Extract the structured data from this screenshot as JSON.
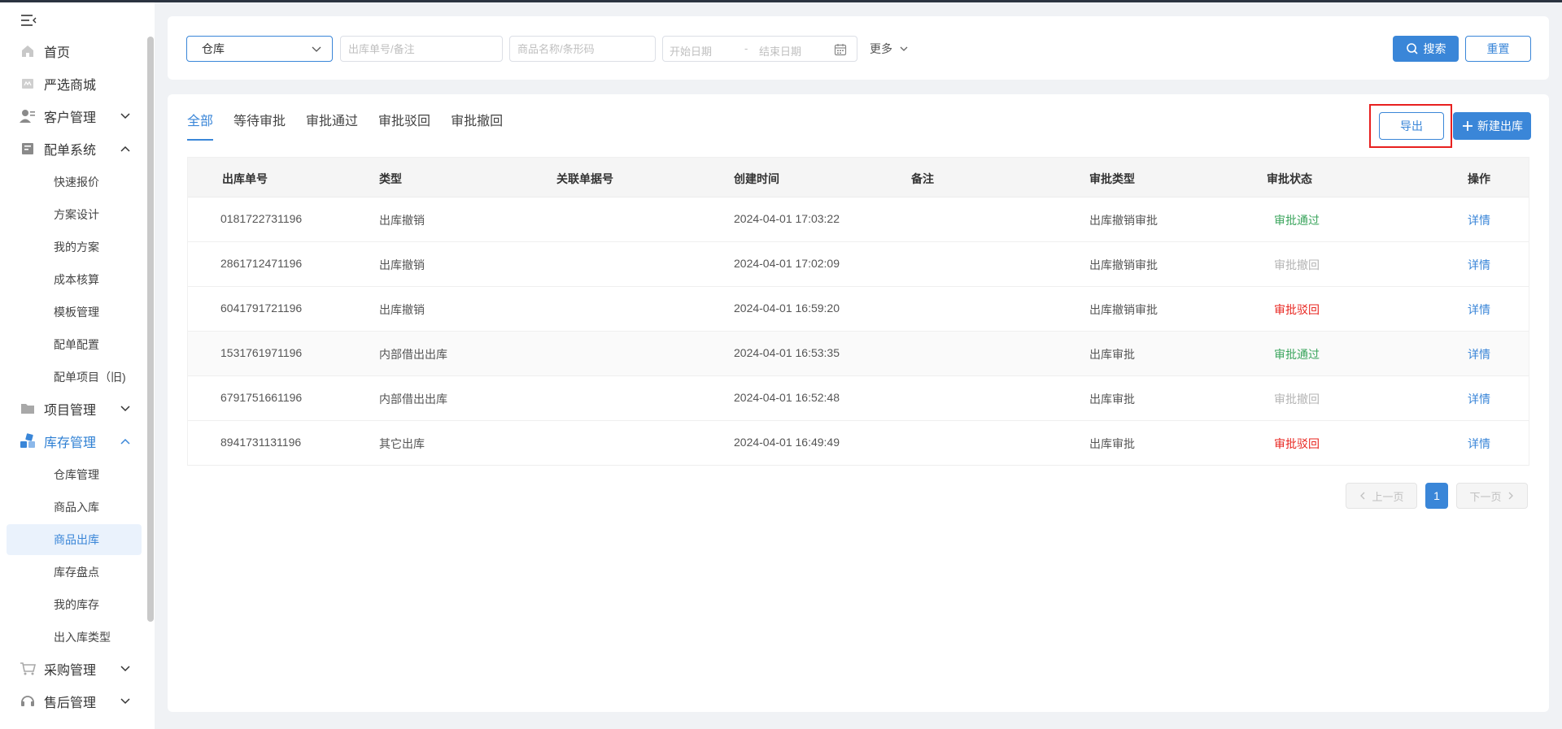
{
  "sidebar": {
    "menu": [
      {
        "label": "首页",
        "icon": "home-icon"
      },
      {
        "label": "严选商城",
        "icon": "mall-icon"
      },
      {
        "label": "客户管理",
        "icon": "customer-icon"
      },
      {
        "label": "配单系统",
        "icon": "order-system-icon"
      }
    ],
    "order_sub": [
      "快速报价",
      "方案设计",
      "我的方案",
      "成本核算",
      "模板管理",
      "配单配置",
      "配单项目（旧)"
    ],
    "project": {
      "label": "项目管理",
      "icon": "folder-icon"
    },
    "inventory": {
      "label": "库存管理",
      "icon": "inventory-icon"
    },
    "inventory_sub": [
      "仓库管理",
      "商品入库",
      "商品出库",
      "库存盘点",
      "我的库存",
      "出入库类型"
    ],
    "purchase": {
      "label": "采购管理",
      "icon": "cart-icon"
    },
    "aftersale": {
      "label": "售后管理",
      "icon": "headset-icon"
    }
  },
  "filters": {
    "warehouse_select": "仓库",
    "order_placeholder": "出库单号/备注",
    "product_placeholder": "商品名称/条形码",
    "start_date": "开始日期",
    "date_sep": "-",
    "end_date": "结束日期",
    "more": "更多",
    "search": "搜索",
    "reset": "重置"
  },
  "tabs": [
    "全部",
    "等待审批",
    "审批通过",
    "审批驳回",
    "审批撤回"
  ],
  "actions": {
    "export": "导出",
    "new": "新建出库"
  },
  "table": {
    "headers": [
      "出库单号",
      "类型",
      "关联单据号",
      "创建时间",
      "备注",
      "审批类型",
      "审批状态",
      "操作"
    ],
    "rows": [
      {
        "no": "0181722731196",
        "type": "出库撤销",
        "ref": "",
        "time": "2024-04-01 17:03:22",
        "note": "",
        "approval_type": "出库撤销审批",
        "status": "审批通过",
        "status_kind": "pass",
        "op": "详情"
      },
      {
        "no": "2861712471196",
        "type": "出库撤销",
        "ref": "",
        "time": "2024-04-01 17:02:09",
        "note": "",
        "approval_type": "出库撤销审批",
        "status": "审批撤回",
        "status_kind": "withdraw",
        "op": "详情"
      },
      {
        "no": "6041791721196",
        "type": "出库撤销",
        "ref": "",
        "time": "2024-04-01 16:59:20",
        "note": "",
        "approval_type": "出库撤销审批",
        "status": "审批驳回",
        "status_kind": "reject",
        "op": "详情"
      },
      {
        "no": "1531761971196",
        "type": "内部借出出库",
        "ref": "",
        "time": "2024-04-01 16:53:35",
        "note": "",
        "approval_type": "出库审批",
        "status": "审批通过",
        "status_kind": "pass",
        "op": "详情"
      },
      {
        "no": "6791751661196",
        "type": "内部借出出库",
        "ref": "",
        "time": "2024-04-01 16:52:48",
        "note": "",
        "approval_type": "出库审批",
        "status": "审批撤回",
        "status_kind": "withdraw",
        "op": "详情"
      },
      {
        "no": "8941731131196",
        "type": "其它出库",
        "ref": "",
        "time": "2024-04-01 16:49:49",
        "note": "",
        "approval_type": "出库审批",
        "status": "审批驳回",
        "status_kind": "reject",
        "op": "详情"
      }
    ]
  },
  "pagination": {
    "prev": "上一页",
    "current": "1",
    "next": "下一页"
  },
  "colors": {
    "accent": "#3a86d8",
    "pass": "#3ba55d",
    "reject": "#e8251f",
    "withdraw": "#b4b4b4",
    "highlight_box": "#e8201f"
  }
}
